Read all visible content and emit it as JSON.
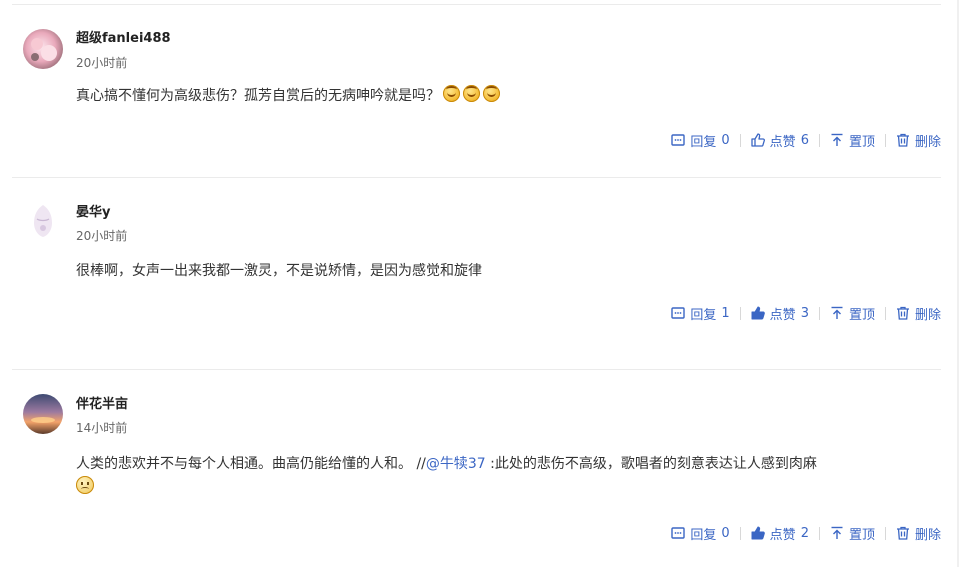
{
  "comments": [
    {
      "username": "超级fanlei488",
      "time": "20小时前",
      "text": "真心搞不懂何为高级悲伤？孤芳自赏后的无病呻吟就是吗？",
      "emojis": [
        "smile-emoji",
        "smile-emoji",
        "smile-emoji"
      ],
      "reply_label": "回复",
      "reply_count": "0",
      "like_label": "点赞",
      "like_count": "6",
      "top_label": "置顶",
      "delete_label": "删除"
    },
    {
      "username": "晏华y",
      "time": "20小时前",
      "text": "很棒啊，女声一出来我都一激灵，不是说矫情，是因为感觉和旋律",
      "reply_label": "回复",
      "reply_count": "1",
      "like_label": "点赞",
      "like_count": "3",
      "top_label": "置顶",
      "delete_label": "删除"
    },
    {
      "username": "伴花半亩",
      "time": "14小时前",
      "text": "人类的悲欢并不与每个人相通。曲高仍能给懂的人和。 //",
      "mention": "@牛犊37",
      "text_after": " :此处的悲伤不高级，歌唱者的刻意表达让人感到肉麻",
      "emojis": [
        "sad-emoji"
      ],
      "reply_label": "回复",
      "reply_count": "0",
      "like_label": "点赞",
      "like_count": "2",
      "top_label": "置顶",
      "delete_label": "删除"
    }
  ],
  "colors": {
    "accent": "#3b66c4",
    "divider": "#ebebeb"
  }
}
